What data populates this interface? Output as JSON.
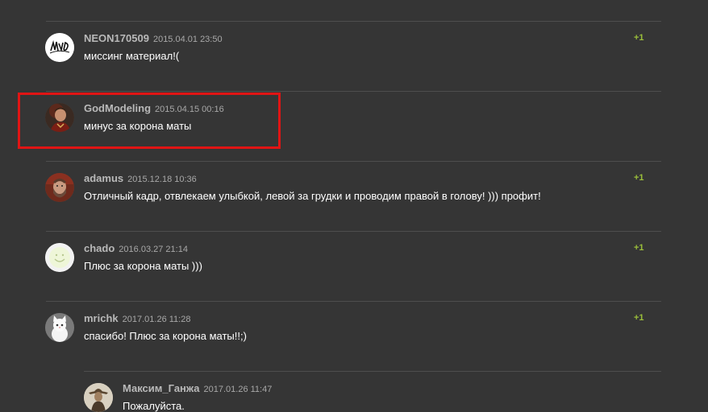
{
  "comments": [
    {
      "author": "NEON170509",
      "date": "2015.04.01 23:50",
      "text": "миссинг материал!(",
      "vote": "+1",
      "avatar": "neon-tag-avatar"
    },
    {
      "author": "GodModeling",
      "date": "2015.04.15 00:16",
      "text": "минус за корона маты",
      "vote": "",
      "avatar": "portrait-avatar",
      "highlighted": true
    },
    {
      "author": "adamus",
      "date": "2015.12.18 10:36",
      "text": "Отличный кадр, отвлекаем улыбкой, левой за грудки и проводим правой в голову! ))) профит!",
      "vote": "+1",
      "avatar": "bearded-man-avatar"
    },
    {
      "author": "chado",
      "date": "2016.03.27 21:14",
      "text": "Плюс за корона маты )))",
      "vote": "+1",
      "avatar": "smiley-avatar"
    },
    {
      "author": "mrichk",
      "date": "2017.01.26 11:28",
      "text": "спасибо! Плюс за корона маты!!;)",
      "vote": "+1",
      "avatar": "white-cat-avatar"
    },
    {
      "author": "Максим_Ганжа",
      "date": "2017.01.26 11:47",
      "text": "Пожалуйста.",
      "vote": "",
      "avatar": "cowboy-avatar",
      "reply": true
    }
  ],
  "colors": {
    "background": "#353535",
    "author": "#b9b9b9",
    "vote": "#9bbf3a",
    "highlight": "#e01414"
  }
}
